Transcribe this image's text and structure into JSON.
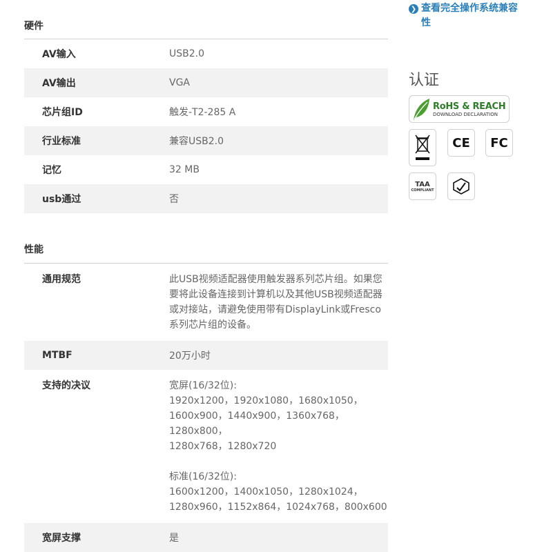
{
  "hardware": {
    "title": "硬件",
    "rows": [
      {
        "key": "AV输入",
        "value": "USB2.0"
      },
      {
        "key": "AV输出",
        "value": "VGA"
      },
      {
        "key": "芯片组ID",
        "value": "触发-T2-285 A"
      },
      {
        "key": "行业标准",
        "value": "兼容USB2.0"
      },
      {
        "key": "记忆",
        "value": "32 MB"
      },
      {
        "key": "usb通过",
        "value": "否"
      }
    ]
  },
  "performance": {
    "title": "性能",
    "general_key": "通用规范",
    "general_value": "此USB视频适配器使用触发器系列芯片组。如果您要将此设备连接到计算机以及其他USB视频适配器或对接站，请避免使用带有DisplayLink或Fresco系列芯片组的设备。",
    "mtbf_key": "MTBF",
    "mtbf_value": "20万小时",
    "res_key": "支持的决议",
    "res_wide_label": "宽屏(16/32位):",
    "res_wide_list": "1920x1200，1920x1080，1680x1050，\n1600x900，1440x900，1360x768，1280x800，\n1280x768，1280x720",
    "res_std_label": "标准(16/32位):",
    "res_std_list": "1600x1200，1400x1050，1280x1024，\n1280x960，1152x864，1024x768，800x600",
    "widescreen_key": "宽屏支撑",
    "widescreen_value": "是"
  },
  "sidebar": {
    "compat_link": "查看完全操作系统兼容性",
    "cert_title": "认证",
    "rohs_line1": "RoHS & REACH",
    "rohs_line2": "DOWNLOAD DECLARATION",
    "ce_label": "CE",
    "fc_label": "FC",
    "taa_label": "TAA",
    "taa_sub": "COMPLIANT"
  },
  "colors": {
    "link": "#2b7fb8",
    "row_alt": "#f2f2f2",
    "rohs_green": "#2f7d2a"
  }
}
